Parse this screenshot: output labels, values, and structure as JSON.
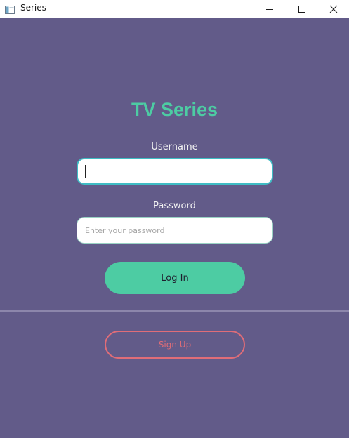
{
  "window": {
    "title": "Series",
    "icons": {
      "app": "app-window-icon",
      "minimize": "minimize-icon",
      "maximize": "maximize-icon",
      "close": "close-icon"
    }
  },
  "login": {
    "heading": "TV Series",
    "username_label": "Username",
    "username_value": "",
    "password_label": "Password",
    "password_placeholder": "Enter your password",
    "login_label": "Log In",
    "signup_label": "Sign Up"
  },
  "colors": {
    "background": "#625b89",
    "accent": "#4dcca3",
    "signup": "#e06d78",
    "focus_border": "#3fbcc4"
  }
}
